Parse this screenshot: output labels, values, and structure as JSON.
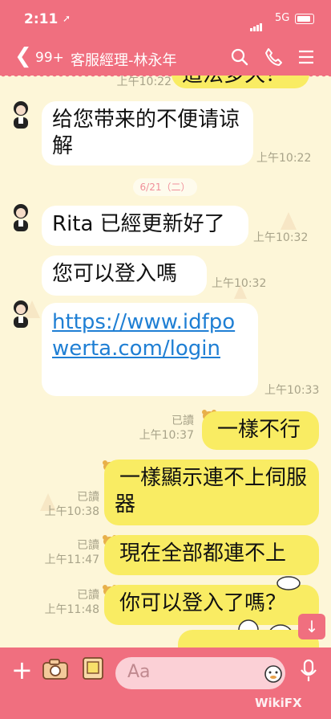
{
  "status_bar": {
    "time": "2:11",
    "location_indicator": "➚",
    "network": "5G"
  },
  "header": {
    "back_glyph": "❮",
    "unread_count": "99+",
    "title": "客服經理-林永年"
  },
  "chat": {
    "date_divider": "6/21（二）",
    "messages": [
      {
        "side": "them",
        "text": "這法多久？",
        "time": "上午10:22"
      },
      {
        "side": "them",
        "text": "给您带来的不便请谅解",
        "time": "上午10:22"
      },
      {
        "side": "them",
        "text": "Rita 已經更新好了",
        "time": "上午10:32"
      },
      {
        "side": "them",
        "text": "您可以登入嗎",
        "time": "上午10:32"
      },
      {
        "side": "them",
        "text": "https://www.idfpowerta.com/login",
        "time": "上午10:33"
      },
      {
        "side": "me",
        "text": "一樣不行",
        "read": "已讀",
        "time": "上午10:37"
      },
      {
        "side": "me",
        "text": "一樣顯示連不上伺服器",
        "read": "已讀",
        "time": "上午10:38"
      },
      {
        "side": "me",
        "text": "現在全部都連不上",
        "read": "已讀",
        "time": "上午11:47"
      },
      {
        "side": "me",
        "text": "你可以登入了嗎？",
        "read": "已讀",
        "time": "上午11:48"
      }
    ]
  },
  "composer": {
    "placeholder": "Aa",
    "plus_glyph": "+"
  },
  "scroll_button_glyph": "↓",
  "watermark": "WikiFX",
  "colors": {
    "accent": "#f06f7f",
    "chat_bg": "#fdf6d8",
    "my_bubble": "#f9ec63",
    "their_bubble": "#ffffff",
    "link": "#1f7fd4"
  }
}
